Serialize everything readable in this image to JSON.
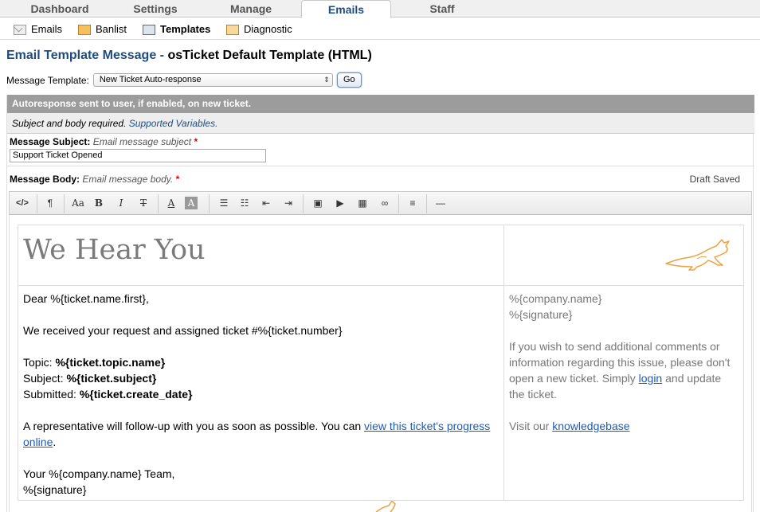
{
  "topnav": {
    "tabs": [
      {
        "label": "Dashboard"
      },
      {
        "label": "Settings"
      },
      {
        "label": "Manage"
      },
      {
        "label": "Emails",
        "active": true
      },
      {
        "label": "Staff"
      }
    ]
  },
  "subnav": {
    "items": [
      {
        "label": "Emails",
        "icon": "mail-icon"
      },
      {
        "label": "Banlist",
        "icon": "banlist-icon"
      },
      {
        "label": "Templates",
        "icon": "templates-icon",
        "active": true
      },
      {
        "label": "Diagnostic",
        "icon": "diagnostic-icon"
      }
    ]
  },
  "page": {
    "title": "Email Template Message",
    "title_sep": " - ",
    "template_name": "osTicket Default Template (HTML)"
  },
  "template_select": {
    "label": "Message Template:",
    "selected": "New Ticket Auto-response",
    "go_label": "Go"
  },
  "form": {
    "header": "Autoresponse sent to user, if enabled, on new ticket.",
    "note": "Subject and body required.",
    "note_link": "Supported Variables.",
    "subject_label": "Message Subject:",
    "subject_hint": "Email message subject",
    "required_mark": "*",
    "subject_value": "Support Ticket Opened",
    "body_label": "Message Body:",
    "body_hint": "Email message body.",
    "draft_status": "Draft Saved"
  },
  "toolbar": {
    "buttons": [
      "html",
      "paragraph",
      "font",
      "bold",
      "italic",
      "strikethrough",
      "font-color",
      "back-color",
      "unordered-list",
      "ordered-list",
      "outdent",
      "indent",
      "image",
      "video",
      "table",
      "link",
      "alignment",
      "horizontal-rule"
    ]
  },
  "editor": {
    "heading": "We Hear You",
    "greeting": "Dear %{ticket.name.first},",
    "received": "We received your request and assigned ticket #%{ticket.number}",
    "topic_label": "Topic: ",
    "topic_value": "%{ticket.topic.name}",
    "subject_label": "Subject: ",
    "subject_value": "%{ticket.subject}",
    "submitted_label": "Submitted: ",
    "submitted_value": "%{ticket.create_date}",
    "followup_text": "A representative will follow-up with you as soon as possible. You can ",
    "followup_link": "view this ticket's progress online",
    "followup_end": ".",
    "signoff": "Your %{company.name} Team,",
    "signature": "%{signature}",
    "side_company": "%{company.name}",
    "side_signature": "%{signature}",
    "side_text1": "If you wish to send additional comments or information regarding this issue, please don't open a new ticket. Simply ",
    "side_login": "login",
    "side_text2": " and update the ticket.",
    "side_visit": "Visit our ",
    "side_kb": "knowledgebase"
  },
  "colors": {
    "brand_blue": "#1f4c80",
    "header_gray": "#9c9c9c",
    "link_blue": "#1d5bb8",
    "logo_orange": "#f0a040"
  }
}
